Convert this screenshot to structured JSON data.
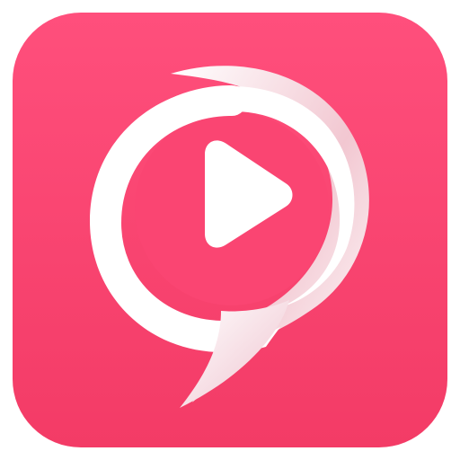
{
  "icon": {
    "name": "speech-bubble-play-icon",
    "colors": {
      "background_top": "#FF4F7C",
      "background_bottom": "#F33B66",
      "glyph": "#FFFFFF",
      "glyph_shadow": "#F2C7D1",
      "play_triangle": "#FFFFFF"
    }
  }
}
